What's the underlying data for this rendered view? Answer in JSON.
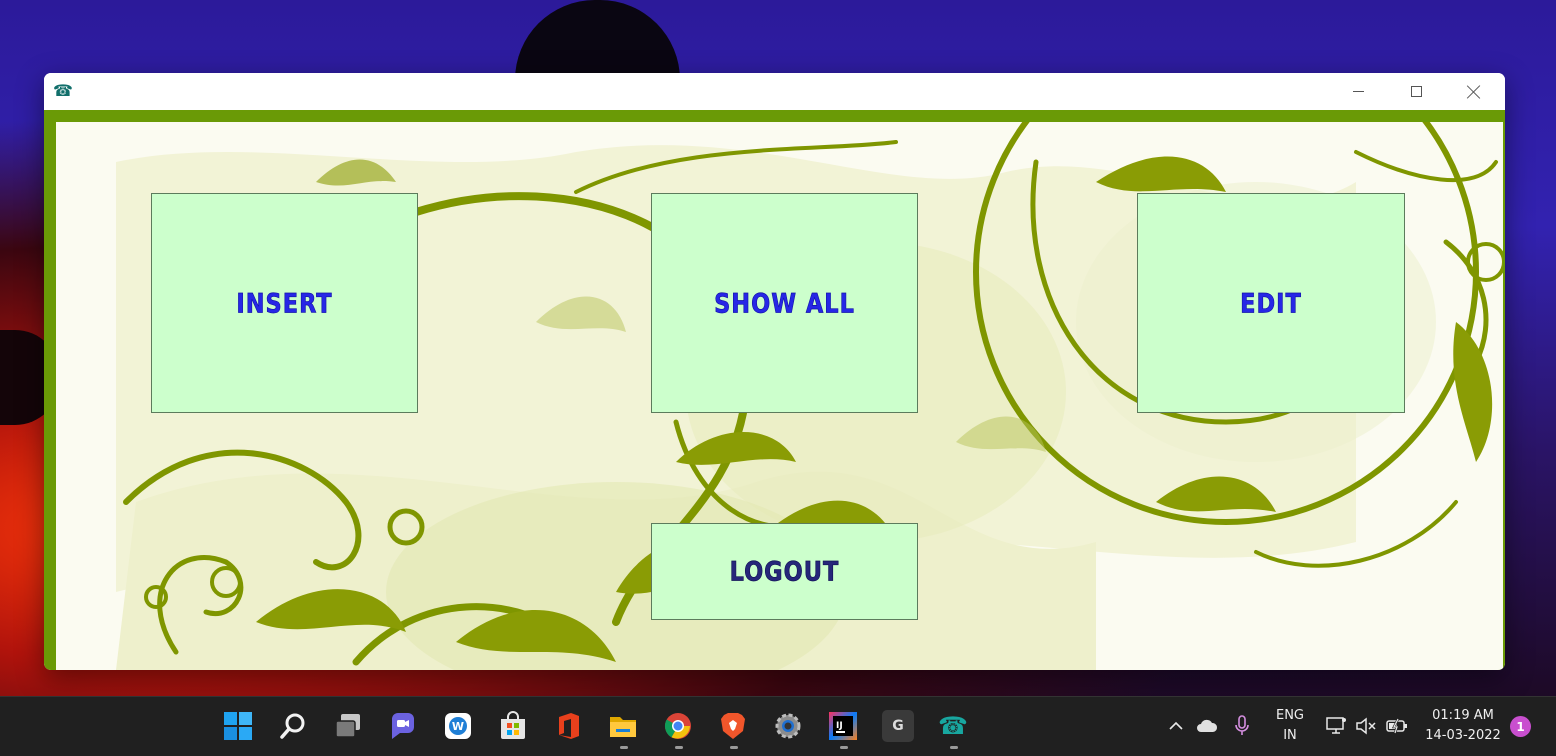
{
  "app": {
    "icon": "telephone-icon",
    "icon_glyph": "☎",
    "title": ""
  },
  "window_controls": {
    "minimize": "minimize-icon",
    "maximize": "maximize-icon",
    "close": "close-icon"
  },
  "menu": {
    "insert_label": "INSERT",
    "show_all_label": "SHOW ALL",
    "edit_label": "EDIT",
    "logout_label": "LOGOUT"
  },
  "colors": {
    "frame": "#6a9a06",
    "tile_bg": "#ccffcc",
    "tile_text": "#2727e6",
    "logout_text": "#26267a",
    "swirl": "#7f9600",
    "taskbar": "#202020"
  },
  "taskbar": {
    "apps": [
      {
        "name": "start-icon",
        "glyph": ""
      },
      {
        "name": "search-icon",
        "glyph": ""
      },
      {
        "name": "task-view-icon",
        "glyph": ""
      },
      {
        "name": "chat-icon",
        "glyph": ""
      },
      {
        "name": "widgets-icon",
        "glyph": ""
      },
      {
        "name": "store-icon",
        "glyph": ""
      },
      {
        "name": "office-icon",
        "glyph": ""
      },
      {
        "name": "file-explorer-icon",
        "glyph": ""
      },
      {
        "name": "chrome-icon",
        "glyph": ""
      },
      {
        "name": "brave-icon",
        "glyph": ""
      },
      {
        "name": "settings-icon",
        "glyph": ""
      },
      {
        "name": "intellij-icon",
        "glyph": "IJ"
      },
      {
        "name": "g-app-icon",
        "glyph": "G"
      },
      {
        "name": "telephone-app-icon",
        "glyph": "☎"
      }
    ],
    "language": {
      "line1": "ENG",
      "line2": "IN"
    },
    "time": "01:19 AM",
    "date": "14-03-2022",
    "notification_count": "1"
  }
}
